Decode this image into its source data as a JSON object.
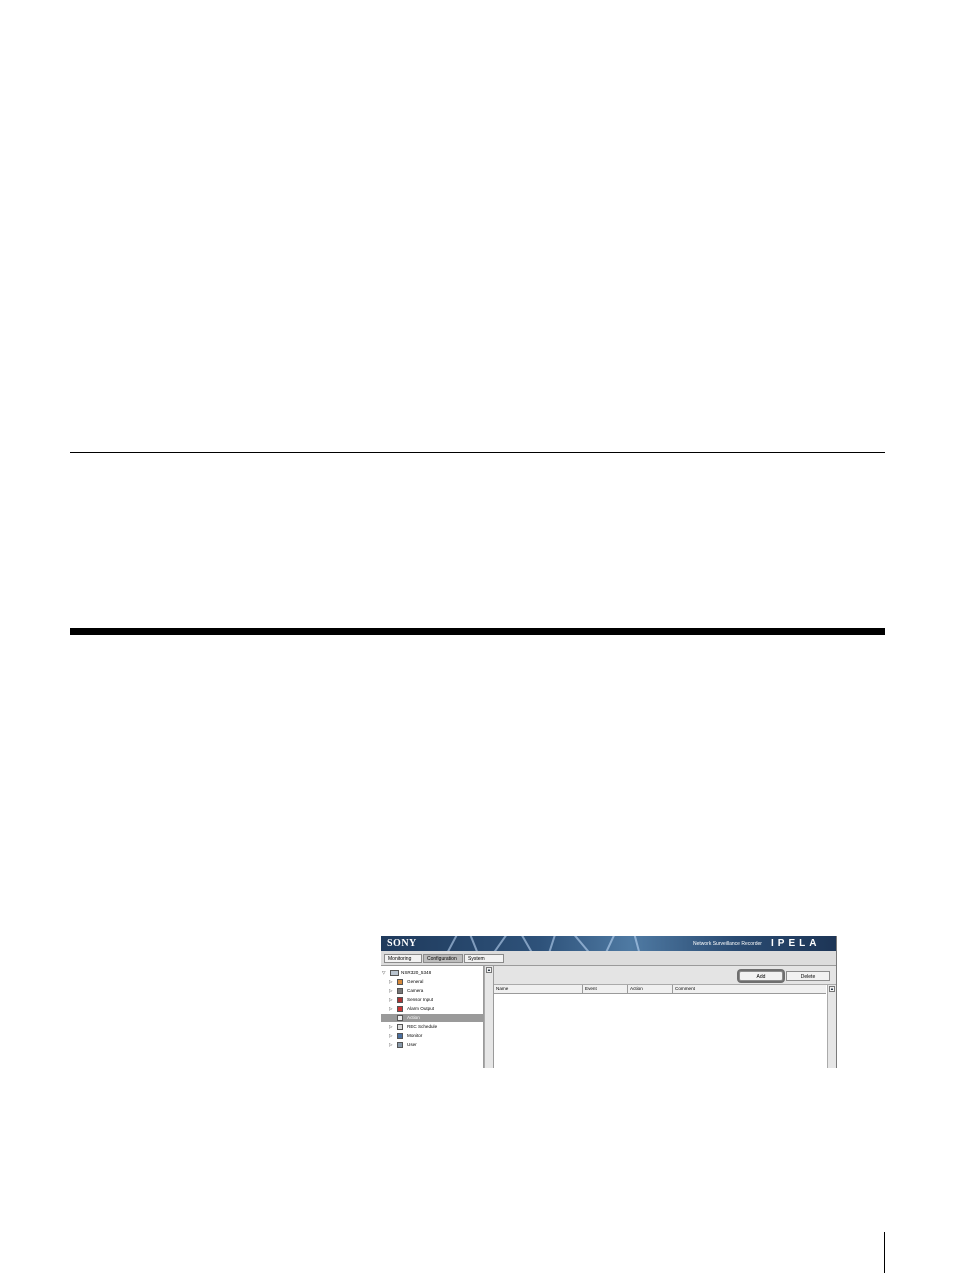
{
  "screenshot": {
    "brand": "SONY",
    "product_name": "Network Surveillance Recorder",
    "product_logo": "IPELA",
    "tabs": [
      {
        "label": "Monitoring",
        "active": false
      },
      {
        "label": "Configuration",
        "active": true
      },
      {
        "label": "System",
        "active": false
      }
    ],
    "tree": {
      "root": {
        "label": "NSR320_5348",
        "icon": "server-icon",
        "expanded": true
      },
      "items": [
        {
          "label": "General",
          "icon": "tools-icon",
          "expanded": false,
          "selected": false
        },
        {
          "label": "Camera",
          "icon": "camera-icon",
          "expanded": false,
          "selected": false
        },
        {
          "label": "Sensor Input",
          "icon": "sensor-icon",
          "expanded": false,
          "selected": false
        },
        {
          "label": "Alarm Output",
          "icon": "alarm-icon",
          "expanded": false,
          "selected": false
        },
        {
          "label": "Action",
          "icon": "action-icon",
          "expanded": false,
          "selected": true
        },
        {
          "label": "REC Schedule",
          "icon": "schedule-icon",
          "expanded": false,
          "selected": false
        },
        {
          "label": "Monitor",
          "icon": "monitor-icon",
          "expanded": false,
          "selected": false
        },
        {
          "label": "User",
          "icon": "user-icon",
          "expanded": false,
          "selected": false
        }
      ]
    },
    "toolbar": {
      "add_label": "Add",
      "delete_label": "Delete"
    },
    "table": {
      "columns": [
        "Name",
        "Event",
        "Action",
        "Comment"
      ],
      "rows": []
    },
    "colors": {
      "header_dark": "#1f3a5c",
      "header_light": "#4f7aa3",
      "selected_row": "#9a9a9a"
    }
  }
}
